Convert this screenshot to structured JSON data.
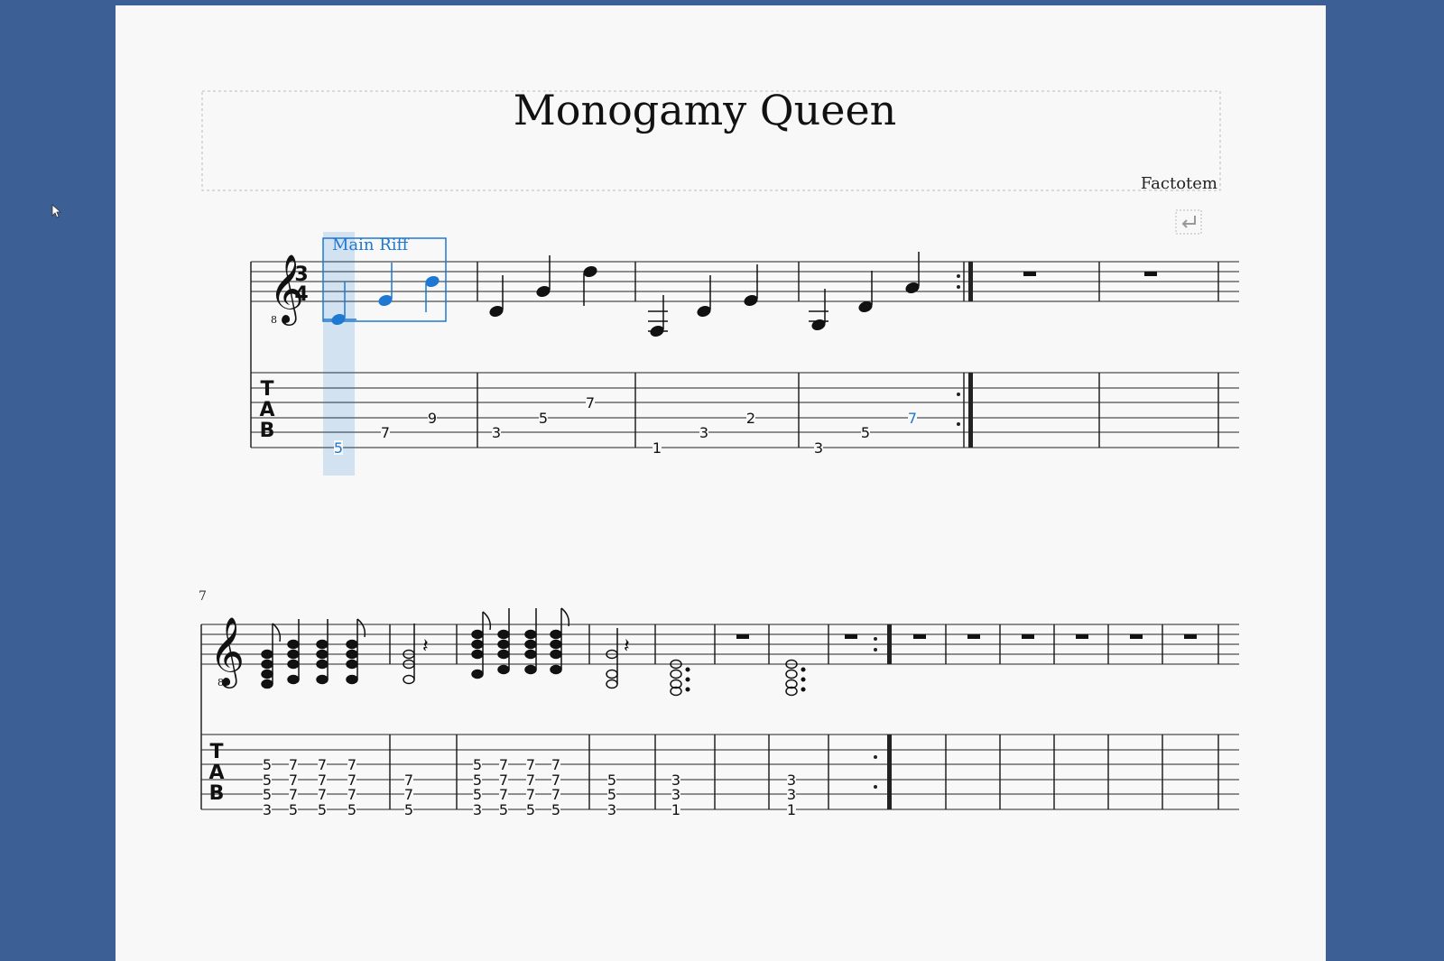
{
  "score": {
    "title": "Monogamy Queen",
    "composer": "Factotem",
    "time_signature": {
      "numerator": "3",
      "denominator": "4"
    },
    "tab_clef": [
      "T",
      "A",
      "B"
    ],
    "octave_mark": "8",
    "selection": {
      "section_label": "Main Riff",
      "color": "#1f78d1"
    },
    "system1": {
      "tab_measures": [
        {
          "notes": [
            {
              "s": 6,
              "f": "5",
              "sel": true
            },
            {
              "s": 5,
              "f": "7"
            },
            {
              "s": 4,
              "f": "9"
            }
          ]
        },
        {
          "notes": [
            {
              "s": 5,
              "f": "3"
            },
            {
              "s": 4,
              "f": "5"
            },
            {
              "s": 3,
              "f": "7"
            }
          ]
        },
        {
          "notes": [
            {
              "s": 6,
              "f": "1"
            },
            {
              "s": 5,
              "f": "3"
            },
            {
              "s": 4,
              "f": "2"
            }
          ]
        },
        {
          "notes": [
            {
              "s": 6,
              "f": "3"
            },
            {
              "s": 5,
              "f": "5"
            },
            {
              "s": 4,
              "f": "7",
              "blue": true
            }
          ]
        },
        {
          "notes": []
        },
        {
          "notes": []
        }
      ]
    },
    "system2": {
      "measure_number": "7",
      "tab_chords": [
        [
          "5",
          "5",
          "5",
          "3"
        ],
        [
          "7",
          "7",
          "7",
          "5"
        ],
        [
          "7",
          "7",
          "7",
          "5"
        ],
        [
          "7",
          "7",
          "7",
          "5"
        ],
        [
          "7",
          "7",
          "5"
        ],
        [
          "5",
          "5",
          "5",
          "3"
        ],
        [
          "7",
          "7",
          "7",
          "5"
        ],
        [
          "7",
          "7",
          "7",
          "5"
        ],
        [
          "7",
          "7",
          "7",
          "5"
        ],
        [
          "5",
          "5",
          "3"
        ],
        [
          "3",
          "3",
          "1"
        ],
        [
          "3",
          "3",
          "1"
        ]
      ]
    }
  }
}
